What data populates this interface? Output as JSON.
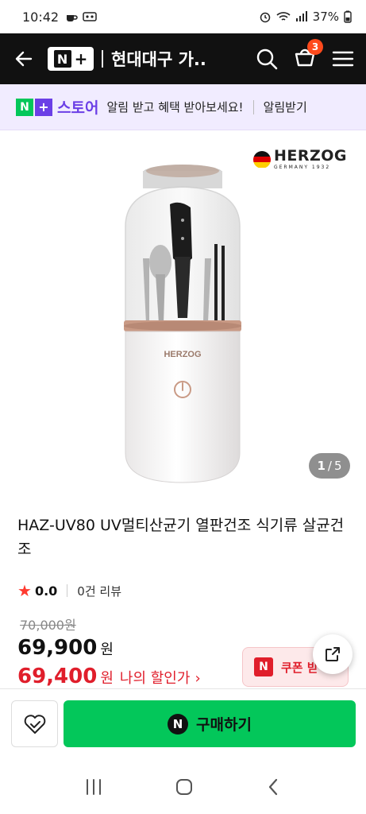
{
  "status": {
    "time": "10:42",
    "battery": "37%"
  },
  "header": {
    "store_title": "현대대구 가...",
    "cart_count": "3"
  },
  "banner": {
    "store_word": "스토어",
    "message": "알림 받고 혜택 받아보세요!",
    "button": "알림받기"
  },
  "product_image": {
    "brand": "HERZOG",
    "brand_sub": "GERMANY 1932",
    "product_label": "HERZOG",
    "current": "1",
    "separator": "/",
    "total": "5"
  },
  "product": {
    "title": "HAZ-UV80 UV멀티산균기 열판건조 식기류 살균건조",
    "rating": "0.0",
    "reviews": "0건 리뷰",
    "original_price": "70,000원",
    "price": "69,900",
    "price_unit": "원",
    "discount_price": "69,400",
    "discount_unit": "원",
    "discount_label": "나의 할인가",
    "coupon_label": "쿠폰 받"
  },
  "bottom": {
    "buy_label": "구매하기"
  },
  "colors": {
    "naver_green": "#03c75a",
    "accent_purple": "#6b3fe6",
    "discount_red": "#e01e2b",
    "header_bg": "#111111"
  }
}
